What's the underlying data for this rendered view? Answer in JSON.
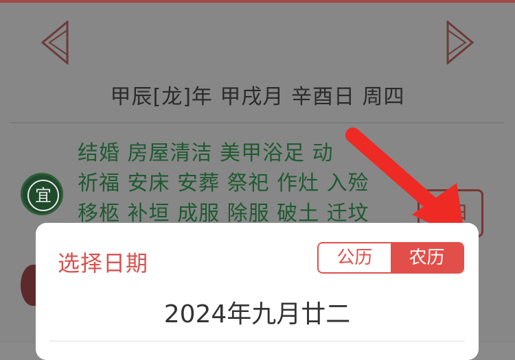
{
  "calendar": {
    "ganzhi": "甲辰[龙]年  甲戌月  辛酉日  周四",
    "yi_badge": "宜",
    "yi_lines": [
      "结婚 房屋清洁 美甲浴足 动",
      "祈福 安床 安葬 祭祀 作灶 入殓",
      "移柩 补垣 成服 除服 破土 迁坟"
    ],
    "jiri_button": "吉日"
  },
  "dialog": {
    "title": "选择日期",
    "toggle": {
      "solar": "公历",
      "lunar": "农历",
      "selected": "lunar"
    },
    "date_value": "2024年九月廿二"
  },
  "colors": {
    "accent": "#e24f4a",
    "title_red": "#d9504f",
    "yi_green": "#1f5a31",
    "arrow_red": "#ee2a24"
  }
}
